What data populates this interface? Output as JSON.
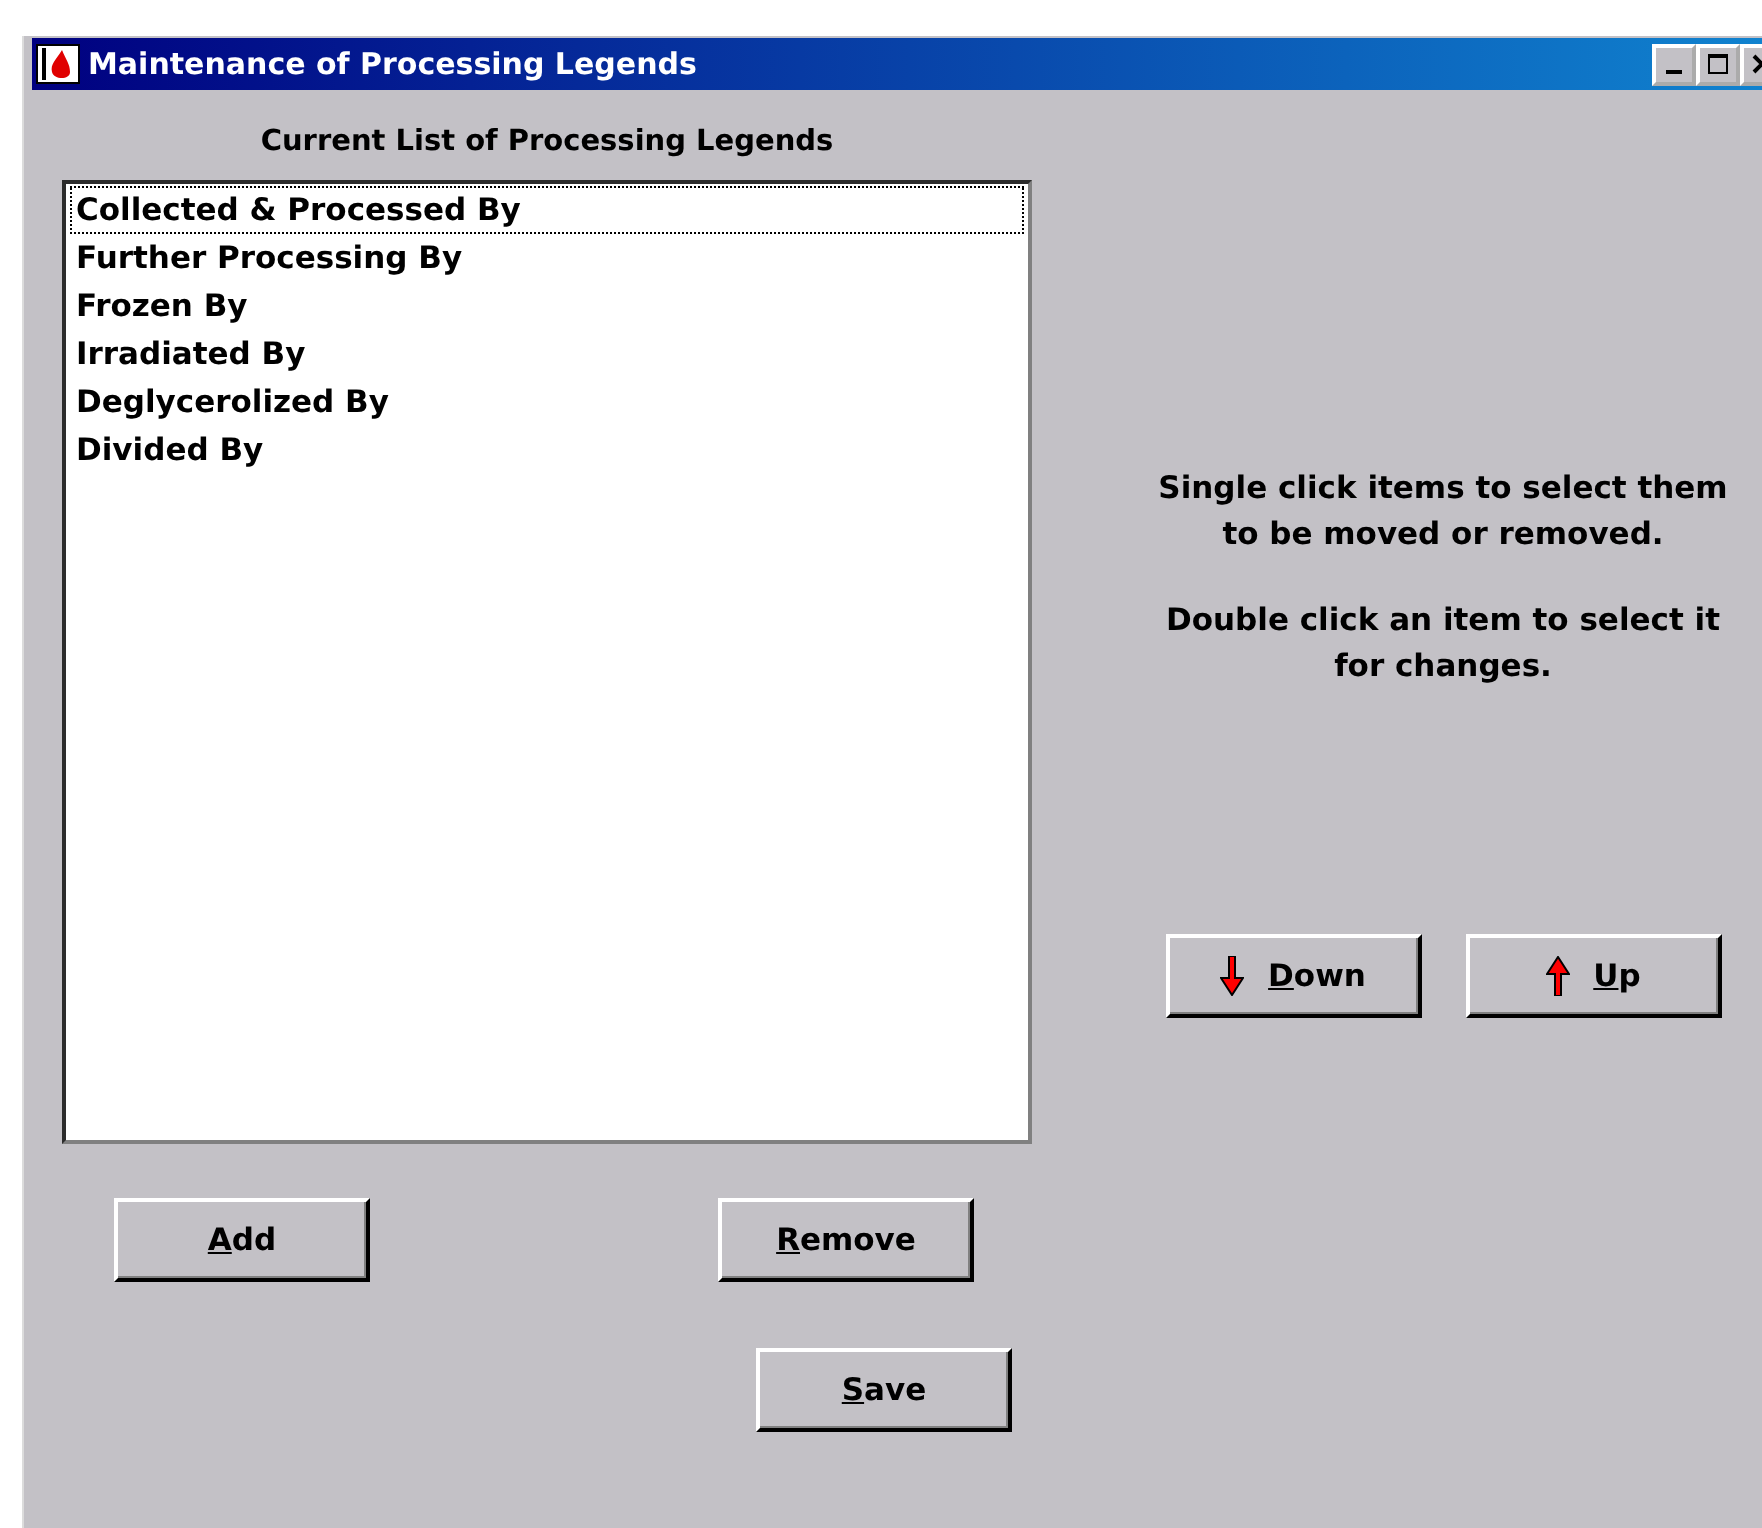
{
  "window": {
    "title": "Maintenance of Processing Legends"
  },
  "list": {
    "heading": "Current List of Processing Legends",
    "items": [
      {
        "label": "Collected & Processed By",
        "focused": true,
        "selected": false
      },
      {
        "label": "Further Processing By",
        "focused": false,
        "selected": false
      },
      {
        "label": "Frozen By",
        "focused": false,
        "selected": false
      },
      {
        "label": "Irradiated By",
        "focused": false,
        "selected": false
      },
      {
        "label": "Deglycerolized By",
        "focused": false,
        "selected": false
      },
      {
        "label": "Divided By",
        "focused": false,
        "selected": false
      }
    ]
  },
  "instructions": [
    "Single click items to select them to be moved or removed.",
    "Double click an item to select it for changes."
  ],
  "move_buttons": [
    {
      "label": "Down",
      "kind": "down"
    },
    {
      "label": "Up",
      "kind": "up"
    }
  ],
  "buttons": {
    "add": "Add",
    "remove": "Remove",
    "save": "Save"
  }
}
